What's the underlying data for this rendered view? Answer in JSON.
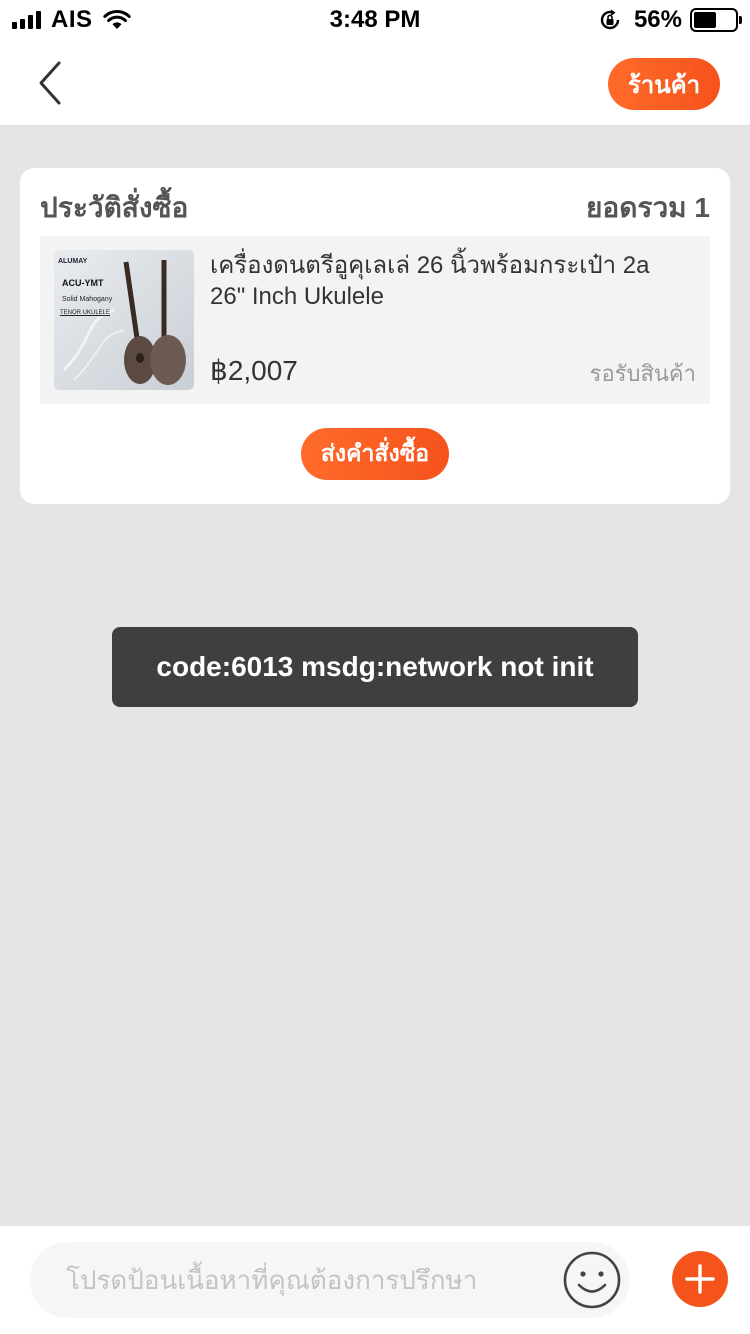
{
  "status_bar": {
    "carrier": "AIS",
    "time": "3:48 PM",
    "battery_percent": "56%",
    "battery_level": 0.56,
    "icons": [
      "signal-icon",
      "wifi-icon",
      "rotation-lock-icon",
      "battery-icon"
    ]
  },
  "nav": {
    "back_icon": "chevron-left-icon",
    "shop_label": "ร้านค้า"
  },
  "order_card": {
    "title": "ประวัติสั่งซื้อ",
    "total": "ยอดรวม 1",
    "item": {
      "name": "เครื่องดนตรีอูคุเลเล่ 26 นิ้วพร้อมกระเป๋า 2a 26\" Inch Ukulele",
      "price": "฿2,007",
      "status": "รอรับสินค้า",
      "image_text": {
        "brand": "ALUMAY",
        "model": "ACU-YMT",
        "material": "Solid Mahogany",
        "type": "TENOR UKULELE"
      }
    },
    "send_order_label": "ส่งคำสั่งซื้อ"
  },
  "toast": {
    "message": "code:6013 msdg:network not init"
  },
  "input_bar": {
    "placeholder": "โปรดป้อนเนื้อหาที่คุณต้องการปรึกษา",
    "emoji_icon": "smiley-icon",
    "add_icon": "plus-icon"
  },
  "colors": {
    "accent": "#f5531c",
    "background": "#e5e5e5",
    "toast_bg": "#3f3f3f"
  }
}
